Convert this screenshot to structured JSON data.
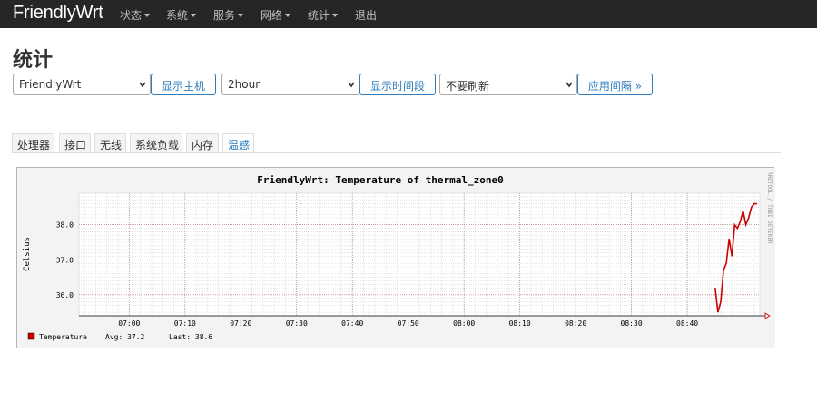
{
  "nav": {
    "brand": "FriendlyWrt",
    "menus": [
      "状态",
      "系统",
      "服务",
      "网络",
      "统计",
      "退出"
    ]
  },
  "page": {
    "title": "统计"
  },
  "controls": {
    "host_select_value": "FriendlyWrt",
    "show_host_label": "显示主机",
    "timespan_select_value": "2hour",
    "show_timespan_label": "显示时间段",
    "refresh_select_value": "不要刷新",
    "apply_interval_label": "应用间隔 »"
  },
  "tabs": [
    "处理器",
    "接口",
    "无线",
    "系统负载",
    "内存",
    "温感"
  ],
  "active_tab": "温感",
  "colors": {
    "accent": "#2f7dbd",
    "navbar": "#262626",
    "series": "#cc0000"
  },
  "chart_data": {
    "type": "line",
    "title": "FriendlyWrt: Temperature of thermal_zone0",
    "ylabel": "Celsius",
    "watermark": "RRDTOOL / TOBI OETIKER",
    "x_ticks": [
      "07:00",
      "07:10",
      "07:20",
      "07:30",
      "07:40",
      "07:50",
      "08:00",
      "08:10",
      "08:20",
      "08:30",
      "08:40"
    ],
    "y_ticks": [
      "38.0",
      "37.0",
      "36.0"
    ],
    "ylim": [
      35.4,
      38.9
    ],
    "xlim": [
      "06:51",
      "08:53"
    ],
    "grid": true,
    "series": [
      {
        "name": "Temperature",
        "x": [
          "08:45",
          "08:45.5",
          "08:46",
          "08:46.5",
          "08:47",
          "08:47.5",
          "08:48",
          "08:48.5",
          "08:49",
          "08:49.5",
          "08:50",
          "08:50.5",
          "08:51",
          "08:51.5",
          "08:52",
          "08:52.5"
        ],
        "values": [
          36.2,
          35.5,
          35.8,
          36.7,
          36.9,
          37.6,
          37.1,
          38.0,
          37.9,
          38.1,
          38.4,
          38.0,
          38.2,
          38.5,
          38.6,
          38.6
        ]
      }
    ],
    "legend": {
      "label": "Temperature",
      "avg": "Avg: 37.2",
      "last": "Last: 38.6"
    }
  }
}
